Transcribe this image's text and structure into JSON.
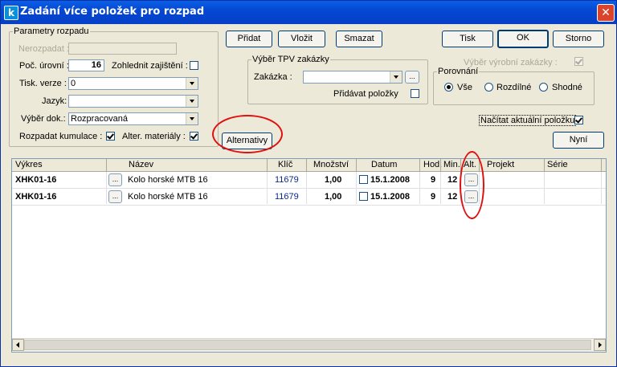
{
  "window": {
    "title": "Zadání více položek pro rozpad",
    "app_icon": "k",
    "close": "✕"
  },
  "params": {
    "legend": "Parametry rozpadu",
    "nerozpadat_label": "Nerozpadat :",
    "nerozpadat_value": "",
    "poc_urovni_label": "Poč. úrovní :",
    "poc_urovni_value": "16",
    "zohlednit_label": "Zohlednit zajištění :",
    "tisk_verze_label": "Tisk. verze :",
    "tisk_verze_value": "0",
    "jazyk_label": "Jazyk:",
    "jazyk_value": "",
    "vyber_dok_label": "Výběr dok.:",
    "vyber_dok_value": "Rozpracovaná",
    "rozpadat_label": "Rozpadat kumulace :",
    "alter_label": "Alter. materiály :"
  },
  "buttons": {
    "pridat": "Přidat",
    "vlozit": "Vložit",
    "smazat": "Smazat",
    "tisk": "Tisk",
    "ok": "OK",
    "storno": "Storno",
    "alternativy": "Alternativy",
    "nyni": "Nyní",
    "ellipsis": "..."
  },
  "tpv": {
    "legend": "Výběr TPV zakázky",
    "zakazka_label": "Zakázka :",
    "zakazka_value": "",
    "pridavat_label": "Přidávat položky"
  },
  "vyrobni_label": "Výběr výrobní zakázky :",
  "porovnani": {
    "legend": "Porovnání",
    "options": [
      "Vše",
      "Rozdílné",
      "Shodné"
    ],
    "selected": "Vše"
  },
  "nacitat_label": "Načítat aktuální položku",
  "grid": {
    "columns": [
      "Výkres",
      "Název",
      "Klíč",
      "Množství",
      "Datum",
      "Hod.",
      "Min.",
      "Alt.",
      "Projekt",
      "Série"
    ],
    "rows": [
      {
        "vykres": "XHK01-16",
        "nazev": "Kolo horské MTB 16",
        "klic": "11679",
        "mnozstvi": "1,00",
        "datum": "15.1.2008",
        "hod": "9",
        "min": "12"
      },
      {
        "vykres": "XHK01-16",
        "nazev": "Kolo horské MTB 16",
        "klic": "11679",
        "mnozstvi": "1,00",
        "datum": "15.1.2008",
        "hod": "9",
        "min": "12"
      }
    ]
  },
  "colors": {
    "titlebar": "#0548d3",
    "face": "#ece9d8",
    "annotation": "#e01010"
  }
}
